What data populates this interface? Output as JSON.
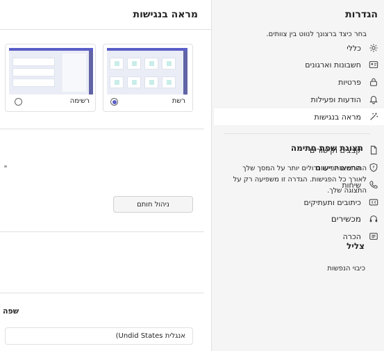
{
  "sidebar": {
    "title": "הגדרות",
    "items": [
      {
        "label": "כללי",
        "icon": "gear-icon"
      },
      {
        "label": "חשבונות וארגונים",
        "icon": "contact-card-icon"
      },
      {
        "label": "פרטיות",
        "icon": "lock-icon"
      },
      {
        "label": "הודעות ופעילות",
        "icon": "bell-icon"
      },
      {
        "label": "מראה בנגישות",
        "icon": "accessibility-wand-icon",
        "selected": true
      },
      {
        "label": "קבצים וקישורים",
        "icon": "file-icon"
      },
      {
        "label": "הרשאות יישום",
        "icon": "shield-icon"
      },
      {
        "label": "שיחות",
        "icon": "phone-icon"
      },
      {
        "label": "כיתובים ותעתיקים",
        "icon": "captions-icon"
      },
      {
        "label": "מכשירים",
        "icon": "headset-icon"
      },
      {
        "label": "הכרה",
        "icon": "about-icon"
      }
    ]
  },
  "main": {
    "title": "מראה בנגישות",
    "layout_prompt": "בחר כיצד ברצונך לנווט בין צוותים.",
    "options": {
      "grid_label": "רשת",
      "list_label": "רשימה",
      "selected": "grid"
    },
    "heatmap": {
      "title": "תצוגת שפת חתימה",
      "description": "החותמים יופיעו גדולים יותר על המסך שלך לאורך כל הפגישות. הגדרה זו משפיעה רק על התצוגה שלך.",
      "side_fragment": "יי",
      "button_label": "ניהול חותם"
    },
    "captions": {
      "title": "צליל",
      "setting_label": "כיבוי הנפשות"
    },
    "language": {
      "title": "שפה",
      "current_value": "אנגלית Undid States)"
    }
  },
  "colors": {
    "accent": "#5b5fc7",
    "sidebar_bg": "#f5f5f5",
    "tile_fill": "#c9ede9"
  }
}
